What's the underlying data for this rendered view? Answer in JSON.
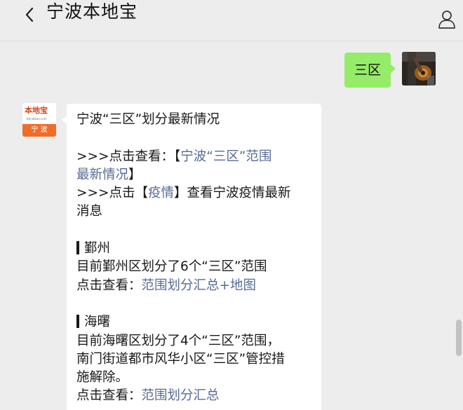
{
  "header": {
    "title": "宁波本地宝"
  },
  "outgoing": {
    "text": "三区"
  },
  "incoming": {
    "avatar": {
      "brand": "本地宝",
      "domain": "Bendibao.com",
      "city": "宁 波"
    },
    "title": "宁波“三区”划分最新情况",
    "link1_prefix": ">>>点击查看：【",
    "link1_text_a": "宁波“三区”范围",
    "link1_text_b": "最新情况",
    "link1_suffix": "】",
    "link2_prefix": ">>>点击【",
    "link2_text": "疫情",
    "link2_suffix_a": "】查看宁波疫情最新",
    "link2_suffix_b": "消息",
    "section1_title": "鄞州",
    "section1_desc": "目前鄞州区划分了6个“三区”范围",
    "section1_link_prefix": "点击查看：",
    "section1_link": "范围划分汇总+地图",
    "section2_title": "海曙",
    "section2_desc_a": "目前海曙区划分了4个“三区”范围，",
    "section2_desc_b": "南门街道都市风华小区“三区”管控措",
    "section2_desc_c": "施解除。",
    "section2_link_prefix": "点击查看：",
    "section2_link": "范围划分汇总"
  },
  "icons": {
    "back": "chevron-left-icon",
    "profile": "person-icon"
  },
  "colors": {
    "background": "#ededed",
    "outgoing_bubble": "#95ec69",
    "incoming_bubble": "#ffffff",
    "link": "#576b95",
    "logo_orange": "#ef6d2a",
    "logo_red": "#d8441c"
  }
}
